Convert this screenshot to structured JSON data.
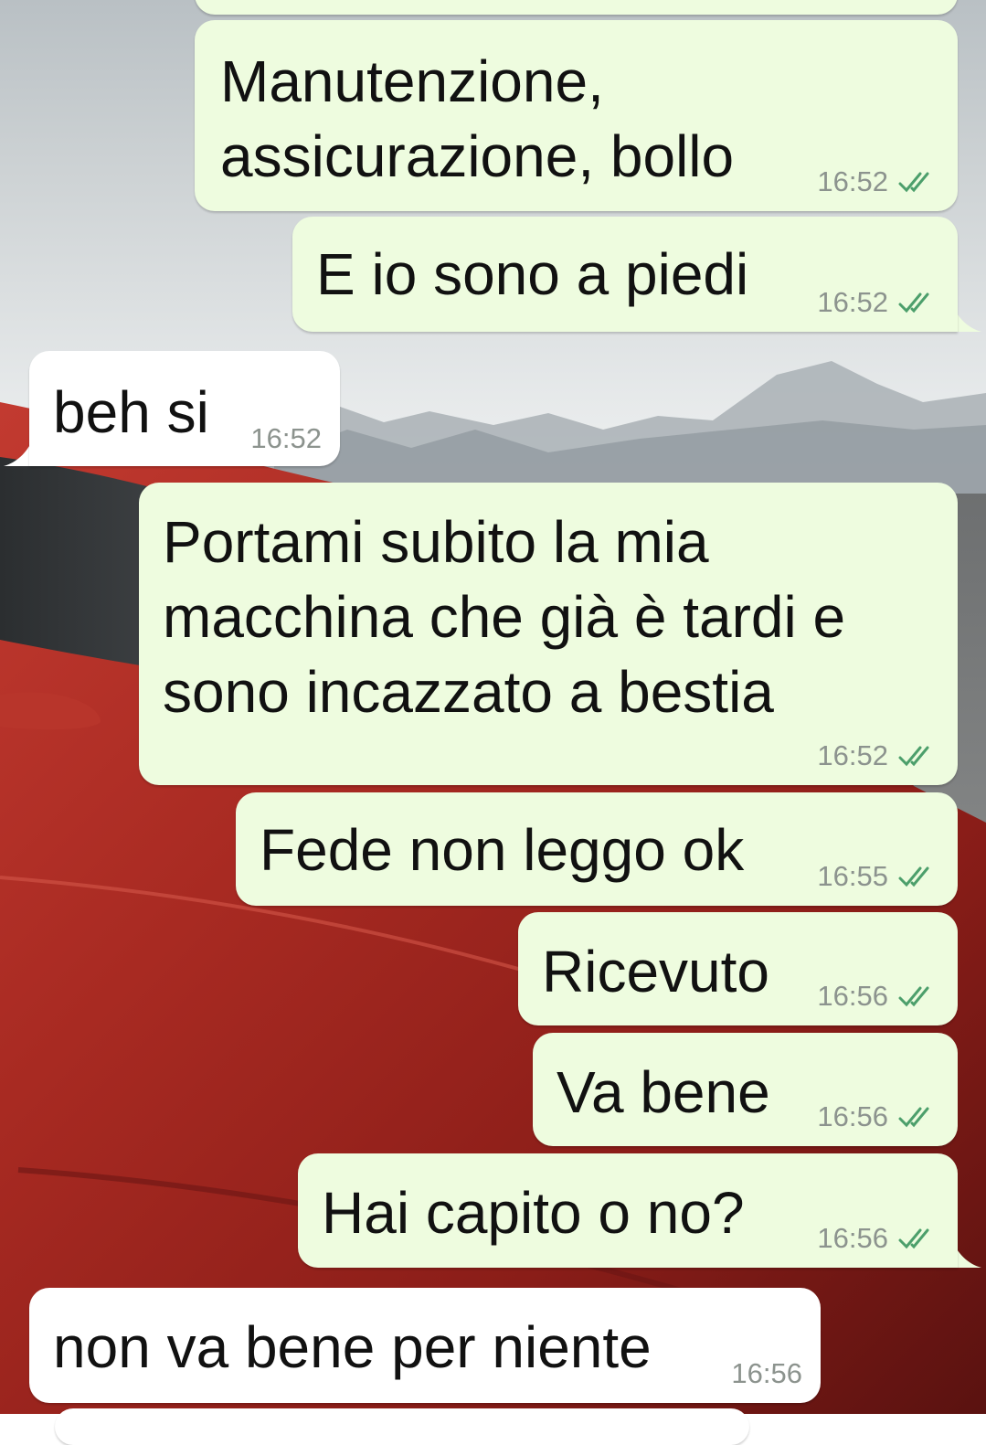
{
  "colors": {
    "outgoing_bubble": "#eefcdf",
    "incoming_bubble": "#ffffff",
    "timestamp": "#8c938e",
    "read_ticks": "#4c9f6b"
  },
  "icons": {
    "read_receipt": "double-check-icon"
  },
  "messages": [
    {
      "direction": "out",
      "lines": [
        "Manutenzione,",
        "assicurazione, bollo"
      ],
      "time": "16:52",
      "status": "read"
    },
    {
      "direction": "out",
      "lines": [
        "E io sono a piedi"
      ],
      "time": "16:52",
      "status": "read"
    },
    {
      "direction": "in",
      "lines": [
        "beh si"
      ],
      "time": "16:52"
    },
    {
      "direction": "out",
      "lines": [
        "Portami subito la mia",
        "macchina che già è tardi e",
        "sono incazzato a bestia"
      ],
      "time": "16:52",
      "status": "read"
    },
    {
      "direction": "out",
      "lines": [
        "Fede non leggo ok"
      ],
      "time": "16:55",
      "status": "read"
    },
    {
      "direction": "out",
      "lines": [
        "Ricevuto"
      ],
      "time": "16:56",
      "status": "read"
    },
    {
      "direction": "out",
      "lines": [
        "Va bene"
      ],
      "time": "16:56",
      "status": "read"
    },
    {
      "direction": "out",
      "lines": [
        "Hai capito o no?"
      ],
      "time": "16:56",
      "status": "read"
    },
    {
      "direction": "in",
      "lines": [
        "non va bene per niente"
      ],
      "time": "16:56"
    }
  ]
}
